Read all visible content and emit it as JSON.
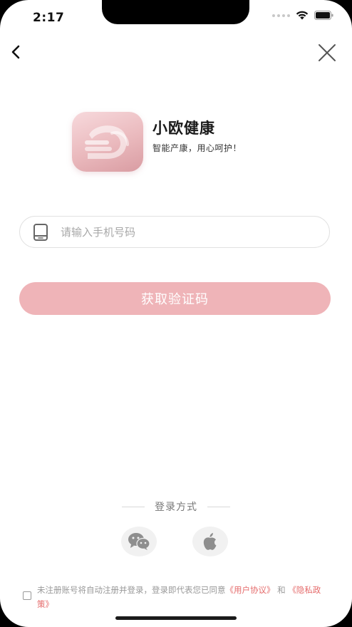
{
  "status_bar": {
    "time": "2:17"
  },
  "nav": {
    "back_icon": "chevron-left-icon",
    "close_icon": "close-icon"
  },
  "app": {
    "name": "小欧健康",
    "slogan": "智能产康，用心呵护！",
    "logo_icon": "app-logo-icon"
  },
  "phone_input": {
    "placeholder": "请输入手机号码",
    "value": "",
    "icon": "phone-icon"
  },
  "get_code_button": {
    "label": "获取验证码"
  },
  "login_methods": {
    "label": "登录方式",
    "wechat_icon": "wechat-icon",
    "apple_icon": "apple-icon"
  },
  "agreement": {
    "checked": false,
    "text_before": "未注册账号将自动注册并登录，登录即代表您已同意",
    "user_agreement": "《用户协议》",
    "conjunction": "和",
    "privacy_policy": "《隐私政策》"
  },
  "colors": {
    "accent": "#efb4b8",
    "link": "#e56b6b",
    "logo_gradient_start": "#f7d9dc",
    "logo_gradient_end": "#d99ca2"
  }
}
